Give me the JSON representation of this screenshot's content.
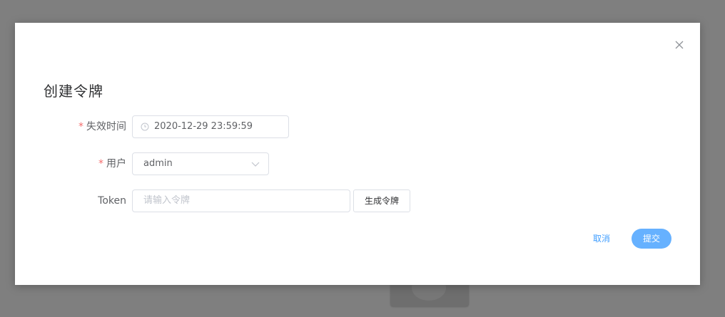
{
  "dialog": {
    "title": "创建令牌",
    "close_icon": "close-icon"
  },
  "form": {
    "required_mark": "*",
    "expire": {
      "label": "失效时间",
      "value": "2020-12-29 23:59:59",
      "icon": "clock-icon"
    },
    "user": {
      "label": "用户",
      "value": "admin",
      "icon": "chevron-down-icon"
    },
    "token": {
      "label": "Token",
      "placeholder": "请输入令牌",
      "generate_label": "生成令牌"
    }
  },
  "footer": {
    "cancel_label": "取消",
    "submit_label": "提交"
  },
  "colors": {
    "overlay": "#7f7f7f",
    "primary": "#409eff",
    "submit_bg": "#66b1ff",
    "required": "#f56c6c"
  }
}
